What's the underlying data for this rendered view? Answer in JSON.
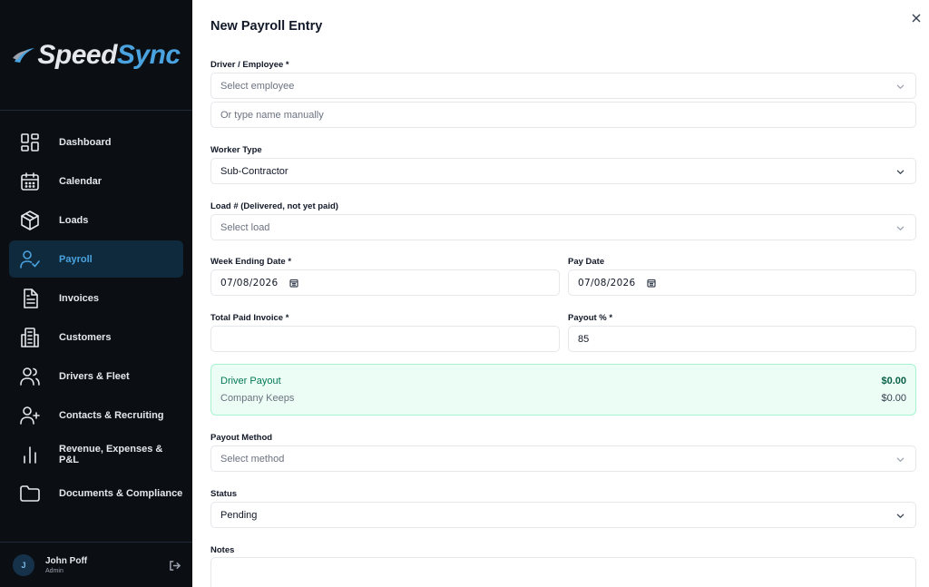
{
  "sidebar": {
    "logo": {
      "part1": "Speed",
      "part2": "Sync"
    },
    "items": [
      {
        "label": "Dashboard",
        "icon": "dashboard-grid-icon"
      },
      {
        "label": "Calendar",
        "icon": "calendar-icon"
      },
      {
        "label": "Loads",
        "icon": "box-icon"
      },
      {
        "label": "Payroll",
        "icon": "user-check-icon",
        "active": true
      },
      {
        "label": "Invoices",
        "icon": "document-icon"
      },
      {
        "label": "Customers",
        "icon": "building-icon"
      },
      {
        "label": "Drivers & Fleet",
        "icon": "users-icon"
      },
      {
        "label": "Contacts & Recruiting",
        "icon": "user-plus-icon"
      },
      {
        "label": "Revenue, Expenses & P&L",
        "icon": "bar-chart-icon"
      },
      {
        "label": "Documents & Compliance",
        "icon": "folder-icon"
      }
    ],
    "user": {
      "initial": "J",
      "name": "John Poff",
      "role": "Admin"
    }
  },
  "form": {
    "title": "New Payroll Entry",
    "driver_label": "Driver / Employee *",
    "driver_select_placeholder": "Select employee",
    "driver_manual_placeholder": "Or type name manually",
    "worker_type_label": "Worker Type",
    "worker_type_value": "Sub-Contractor",
    "load_label": "Load # (Delivered, not yet paid)",
    "load_placeholder": "Select load",
    "week_ending_label": "Week Ending Date *",
    "week_ending_value": "07/08/2026",
    "pay_date_label": "Pay Date",
    "pay_date_value": "07/08/2026",
    "total_paid_label": "Total Paid Invoice *",
    "total_paid_value": "",
    "payout_pct_label": "Payout % *",
    "payout_pct_value": "85",
    "summary": {
      "driver_payout_label": "Driver Payout",
      "driver_payout_value": "$0.00",
      "company_keeps_label": "Company Keeps",
      "company_keeps_value": "$0.00"
    },
    "payout_method_label": "Payout Method",
    "payout_method_placeholder": "Select method",
    "status_label": "Status",
    "status_value": "Pending",
    "notes_label": "Notes",
    "notes_value": ""
  },
  "colors": {
    "sidebar_bg": "#0b0f14",
    "accent": "#4aa3df",
    "active_bg": "#0f2a3d",
    "summary_bg": "#ecfdf5",
    "summary_green": "#047857"
  }
}
